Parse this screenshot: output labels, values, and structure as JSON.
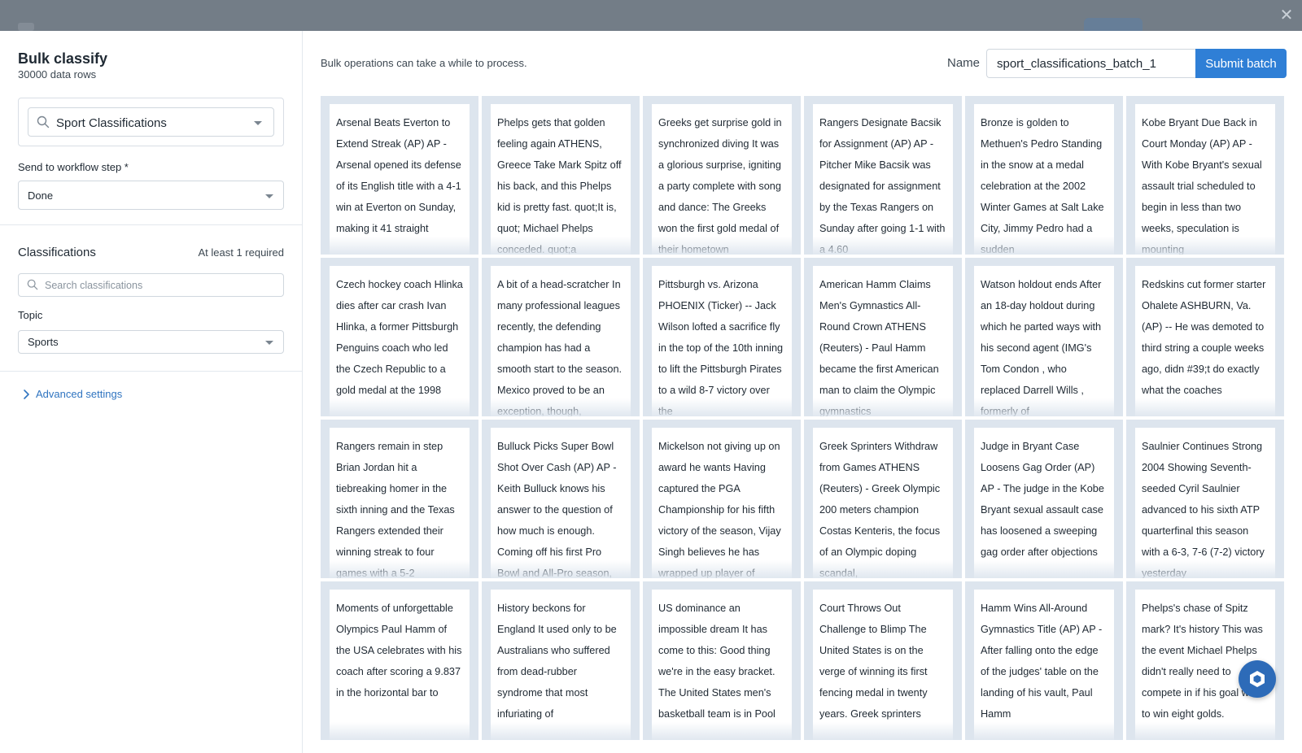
{
  "modal": {
    "title": "Bulk classify",
    "subtitle": "30000 data rows"
  },
  "ontology": {
    "selected": "Sport Classifications"
  },
  "workflow": {
    "label": "Send to workflow step *",
    "selected": "Done"
  },
  "classifications": {
    "title": "Classifications",
    "hint": "At least 1 required",
    "search_placeholder": "Search classifications",
    "topic_label": "Topic",
    "topic_selected": "Sports"
  },
  "advanced": {
    "label": "Advanced settings"
  },
  "batch": {
    "notice": "Bulk operations can take a while to process.",
    "name_label": "Name",
    "name_value": "sport_classifications_batch_1",
    "submit_label": "Submit batch"
  },
  "rows": [
    "Arsenal Beats Everton to Extend Streak (AP) AP - Arsenal opened its defense of its English title with a 4-1 win at Everton on Sunday, making it 41 straight",
    "Phelps gets that golden feeling again ATHENS, Greece  Take Mark Spitz off his back, and this Phelps kid is pretty fast. quot;It is, quot; Michael Phelps conceded.  quot;a",
    "Greeks get surprise gold in synchronized diving It was a glorious surprise, igniting a party complete with song and dance: The Greeks won the first gold medal of their hometown",
    "Rangers Designate Bacsik for Assignment (AP) AP - Pitcher Mike Bacsik was designated for assignment by the Texas Rangers on Sunday after going 1-1 with a 4.60",
    "Bronze is golden to Methuen's Pedro Standing in the snow at a medal celebration at the 2002 Winter Games at Salt Lake City, Jimmy Pedro had a sudden",
    "Kobe Bryant Due Back in Court Monday (AP) AP - With Kobe Bryant's sexual assault trial scheduled to begin in less than two weeks, speculation is mounting",
    "Czech hockey coach Hlinka dies after car crash Ivan Hlinka, a former Pittsburgh Penguins coach who led the Czech Republic to a gold medal at the 1998",
    "A bit of a head-scratcher In many professional leagues recently, the defending champion has had a smooth start to the season. Mexico proved to be an exception, though,",
    "Pittsburgh vs. Arizona PHOENIX (Ticker) -- Jack Wilson lofted a sacrifice fly in the top of the 10th inning to lift the Pittsburgh Pirates to a wild 8-7 victory over the",
    "American Hamm Claims Men's Gymnastics All-Round Crown  ATHENS (Reuters) - Paul Hamm became the first American man  to claim the Olympic gymnastics",
    "Watson holdout ends After an 18-day holdout during which he parted ways with his second agent (IMG's Tom Condon , who replaced Darrell Wills , formerly of",
    "Redskins cut former starter Ohalete ASHBURN, Va. (AP) -- He was demoted to third string a couple weeks ago, didn #39;t do exactly what the coaches",
    "Rangers remain in step Brian Jordan hit a tiebreaking homer in the sixth inning and the Texas Rangers extended their winning streak to four games with a 5-2",
    "Bulluck Picks Super Bowl Shot Over Cash (AP) AP - Keith Bulluck knows his answer to the question of how much is enough. Coming off his first Pro Bowl and All-Pro season,",
    "Mickelson not giving up on award he wants Having captured the PGA Championship for his fifth victory of the season, Vijay Singh believes he has wrapped up player of",
    "Greek Sprinters Withdraw from Games  ATHENS (Reuters) - Greek Olympic 200 meters champion Costas Kenteris, the focus of an Olympic doping scandal,",
    "Judge in Bryant Case Loosens Gag Order (AP) AP - The judge in the Kobe Bryant sexual assault case has loosened a sweeping gag order after objections",
    "Saulnier Continues Strong 2004 Showing Seventh-seeded Cyril Saulnier advanced to his sixth ATP quarterfinal this season with a 6-3, 7-6 (7-2) victory yesterday",
    "Moments of unforgettable Olympics Paul Hamm of the USA celebrates with his coach after scoring a 9.837 in the horizontal bar to",
    "History beckons for England It used only to be Australians who suffered from dead-rubber syndrome  that most infuriating of",
    "US dominance an impossible dream It has come to this: Good thing we're in the easy bracket. The United States men's basketball team is in Pool",
    "Court Throws Out Challenge to Blimp  The United States is on the verge of winning its first fencing medal in twenty years.  Greek sprinters",
    "Hamm Wins All-Around Gymnastics Title (AP) AP - After falling onto the edge of the judges' table on the landing of his vault, Paul Hamm",
    "Phelps's chase of Spitz mark? It's history This was the event Michael Phelps didn't really need to compete in if his goal was to win eight golds."
  ],
  "icons": {
    "close": "close-icon",
    "search": "search-icon",
    "chevron": "chevron-right-icon",
    "help": "help-widget-icon"
  },
  "colors": {
    "accent": "#2f7fd6",
    "link": "#2f74c0",
    "cell_bg": "#dde5ee"
  }
}
